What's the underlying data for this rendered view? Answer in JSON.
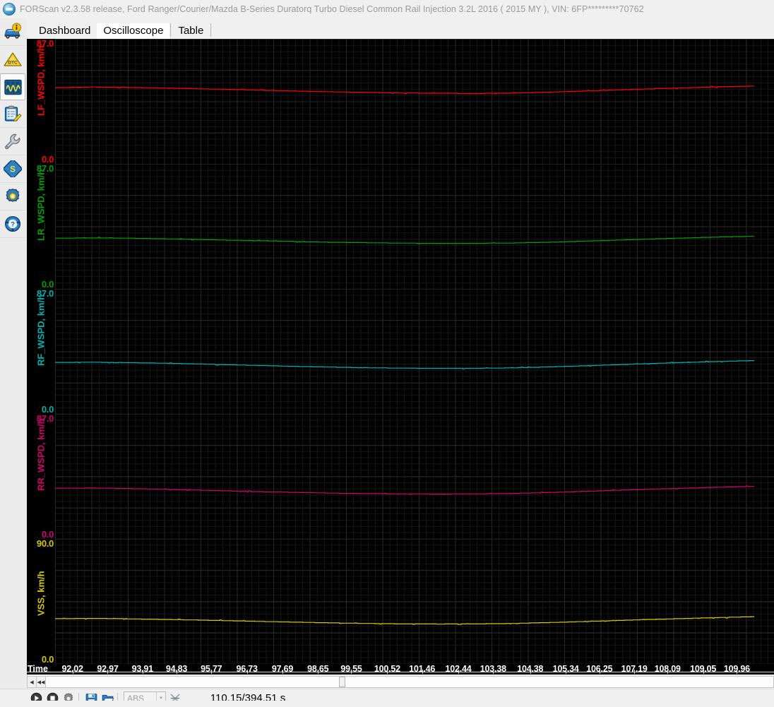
{
  "window": {
    "title": "FORScan v2.3.58 release, Ford Ranger/Courier/Mazda B-Series Duratorq Turbo Diesel Common Rail Injection 3.2L 2016 ( 2015 MY ), VIN: 6FP*********70762",
    "app_icon": "forscan-logo-icon"
  },
  "sidebar": {
    "items": [
      {
        "name": "vehicle-info",
        "icon": "car-info-icon",
        "selected": false
      },
      {
        "name": "dtc-codes",
        "icon": "dtc-warning-triangle-icon",
        "selected": false
      },
      {
        "name": "oscilloscope",
        "icon": "oscilloscope-icon",
        "selected": true
      },
      {
        "name": "service-procedures",
        "icon": "clipboard-pencil-icon",
        "selected": false
      },
      {
        "name": "tests",
        "icon": "wrench-icon",
        "selected": false
      },
      {
        "name": "modules",
        "icon": "chip-module-icon",
        "selected": false
      },
      {
        "name": "configuration",
        "icon": "gear-icon",
        "selected": false
      },
      {
        "name": "help",
        "icon": "help-wheel-icon",
        "selected": false
      }
    ]
  },
  "tabs": [
    {
      "label": "Dashboard",
      "active": false
    },
    {
      "label": "Oscilloscope",
      "active": true
    },
    {
      "label": "Table",
      "active": false
    }
  ],
  "chart_data": {
    "type": "line",
    "title": "",
    "xlabel": "Time",
    "background": "#000000",
    "grid": true,
    "grid_color": "#272727",
    "grid_minor_color": "#161616",
    "legend": "none",
    "xlim": [
      91.55,
      110.43
    ],
    "x_tick_labels": [
      "92.02",
      "92.97",
      "93.91",
      "94.83",
      "95.77",
      "96.73",
      "97.69",
      "98.65",
      "99.55",
      "100.52",
      "101.46",
      "102.44",
      "103.38",
      "104.38",
      "105.34",
      "106.25",
      "107.19",
      "108.09",
      "109.05",
      "109.96"
    ],
    "series": [
      {
        "name": "LF_WSPD",
        "unit": "km/h",
        "color": "#ff0000",
        "ylim": [
          0.0,
          87.0
        ],
        "ymax_label": "87.0",
        "ymin_label": "0.0",
        "x": [
          91.55,
          92.5,
          93.45,
          94.4,
          95.35,
          96.3,
          97.25,
          98.2,
          99.15,
          100.1,
          101.05,
          102.0,
          102.95,
          103.9,
          104.85,
          105.8,
          106.75,
          107.7,
          108.65,
          109.6,
          110.43
        ],
        "values": [
          53.0,
          53.4,
          53.2,
          52.8,
          52.3,
          51.8,
          51.2,
          50.6,
          50.1,
          49.7,
          49.3,
          49.1,
          49.0,
          49.2,
          49.8,
          50.6,
          51.4,
          52.2,
          52.9,
          53.6,
          54.2
        ]
      },
      {
        "name": "LR_WSPD",
        "unit": "km/h",
        "color": "#00a000",
        "ylim": [
          0.0,
          87.0
        ],
        "ymax_label": "87.0",
        "ymin_label": "0.0",
        "x": [
          91.55,
          92.5,
          93.45,
          94.4,
          95.35,
          96.3,
          97.25,
          98.2,
          99.15,
          100.1,
          101.05,
          102.0,
          102.95,
          103.9,
          104.85,
          105.8,
          106.75,
          107.7,
          108.65,
          109.6,
          110.43
        ],
        "values": [
          35.2,
          35.5,
          35.3,
          34.9,
          34.4,
          33.9,
          33.4,
          32.9,
          32.4,
          32.1,
          31.8,
          31.7,
          31.7,
          31.9,
          32.4,
          33.1,
          33.9,
          34.7,
          35.4,
          36.1,
          36.6
        ]
      },
      {
        "name": "RF_WSPD",
        "unit": "km/h",
        "color": "#00b0b0",
        "ylim": [
          0.0,
          87.0
        ],
        "ymax_label": "87.0",
        "ymin_label": "0.0",
        "x": [
          91.55,
          92.5,
          93.45,
          94.4,
          95.35,
          96.3,
          97.25,
          98.2,
          99.15,
          100.1,
          101.05,
          102.0,
          102.95,
          103.9,
          104.85,
          105.8,
          106.75,
          107.7,
          108.65,
          109.6,
          110.43
        ],
        "values": [
          35.8,
          36.0,
          35.7,
          35.3,
          34.8,
          34.2,
          33.6,
          33.0,
          32.5,
          32.1,
          31.8,
          31.7,
          31.7,
          32.0,
          32.6,
          33.4,
          34.2,
          35.0,
          35.8,
          36.5,
          37.1
        ]
      },
      {
        "name": "RR_WSPD",
        "unit": "km/h",
        "color": "#d0006a",
        "ylim": [
          0.0,
          87.0
        ],
        "ymax_label": "87.0",
        "ymin_label": "0.0",
        "x": [
          91.55,
          92.5,
          93.45,
          94.4,
          95.35,
          96.3,
          97.25,
          98.2,
          99.15,
          100.1,
          101.05,
          102.0,
          102.95,
          103.9,
          104.85,
          105.8,
          106.75,
          107.7,
          108.65,
          109.6,
          110.43
        ],
        "values": [
          35.2,
          35.4,
          35.1,
          34.6,
          34.0,
          33.4,
          32.8,
          32.3,
          31.8,
          31.5,
          31.3,
          31.2,
          31.3,
          31.6,
          32.2,
          33.0,
          33.8,
          34.6,
          35.3,
          36.0,
          36.6
        ]
      },
      {
        "name": "VSS",
        "unit": "km/h",
        "color": "#d4c800",
        "ylim": [
          0.0,
          90.0
        ],
        "ymax_label": "90.0",
        "ymin_label": "0.0",
        "x": [
          91.55,
          92.5,
          93.45,
          94.4,
          95.35,
          96.3,
          97.25,
          98.2,
          99.15,
          100.1,
          101.05,
          102.0,
          102.95,
          103.9,
          104.85,
          105.8,
          106.75,
          107.7,
          108.65,
          109.6,
          110.43
        ],
        "values": [
          32.5,
          32.8,
          32.5,
          32.1,
          31.6,
          31.1,
          30.5,
          30.0,
          29.5,
          29.1,
          28.8,
          28.7,
          28.8,
          29.1,
          29.7,
          30.4,
          31.2,
          32.0,
          32.7,
          33.4,
          34.0
        ]
      }
    ]
  },
  "toolbar": {
    "record_icon": "record-play-icon",
    "stop_icon": "stop-icon",
    "settings_icon": "gear-icon",
    "save_icon": "save-floppy-icon",
    "open_icon": "open-folder-icon",
    "module_select_value": "ABS",
    "module_select_arrow": "chevron-down-icon",
    "clear_icon": "clear-chart-icon",
    "time_readout": "110.15/394.51 s"
  },
  "scrollbar": {
    "left_step_icon": "scroll-left-icon",
    "left_page_icon": "scroll-page-left-icon",
    "thumb_position_pct": 41.5
  }
}
